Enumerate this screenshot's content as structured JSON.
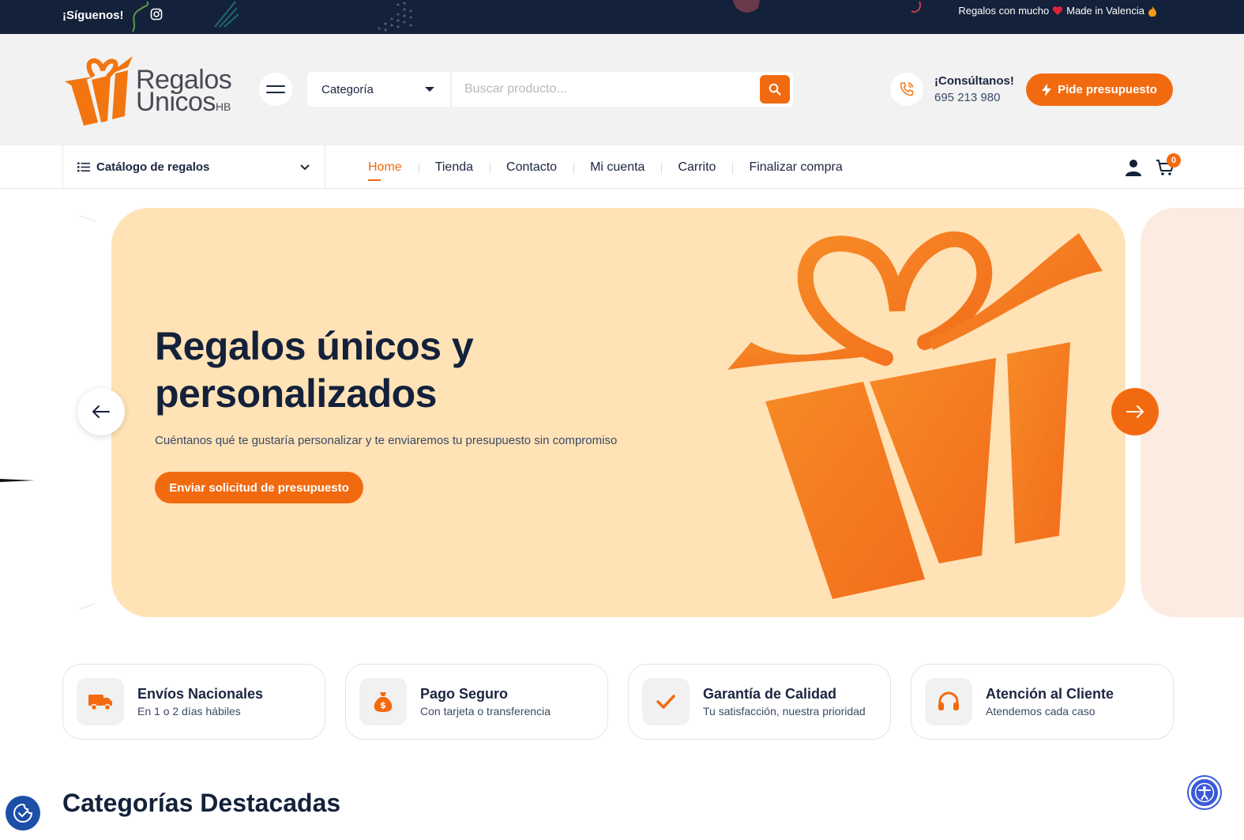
{
  "topbar": {
    "follow_label": "¡Síguenos!",
    "tagline_start": "Regalos con mucho",
    "tagline_end": "Made in Valencia"
  },
  "header": {
    "logo_line1": "Regalos",
    "logo_line2": "Unicos",
    "logo_suffix": "HB",
    "search_category": "Categoría",
    "search_placeholder": "Buscar producto...",
    "consult_label": "¡Consúltanos!",
    "phone": "695 213 980",
    "quote_label": "Pide presupuesto"
  },
  "nav": {
    "catalog_label": "Catálogo de regalos",
    "items": [
      {
        "label": "Home",
        "active": true
      },
      {
        "label": "Tienda"
      },
      {
        "label": "Contacto"
      },
      {
        "label": "Mi cuenta"
      },
      {
        "label": "Carrito"
      },
      {
        "label": "Finalizar compra"
      }
    ],
    "cart_count": "0"
  },
  "hero": {
    "title": "Regalos únicos y personalizados",
    "subtitle": "Cuéntanos qué te gustaría personalizar y te enviaremos tu presupuesto sin compromiso",
    "cta_label": "Enviar solicitud de presupuesto"
  },
  "features": [
    {
      "title": "Envíos Nacionales",
      "subtitle": "En 1 o 2 días hábiles",
      "icon": "truck-icon"
    },
    {
      "title": "Pago Seguro",
      "subtitle": "Con tarjeta o transferencia",
      "icon": "money-bag-icon"
    },
    {
      "title": "Garantía de Calidad",
      "subtitle": "Tu satisfacción, nuestra prioridad",
      "icon": "check-icon"
    },
    {
      "title": "Atención al Cliente",
      "subtitle": "Atendemos cada caso",
      "icon": "headphones-icon"
    }
  ],
  "section": {
    "title": "Categorías Destacadas"
  },
  "colors": {
    "brand": "#f26a10",
    "navy": "#14213a",
    "hero_bg": "#ffe2b6"
  }
}
